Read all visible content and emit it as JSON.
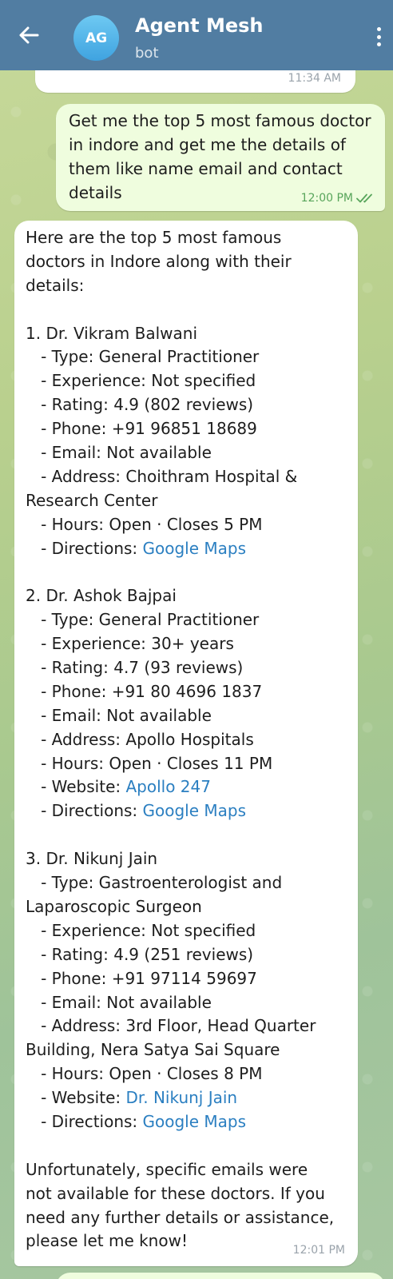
{
  "header": {
    "title": "Agent Mesh",
    "subtitle": "bot",
    "avatar_initials": "AG"
  },
  "previous_message": {
    "time": "11:34 AM"
  },
  "outgoing_message": {
    "text": "Get me the top 5 most famous doctor\nin indore and get me the details of\nthem like name email and contact\ndetails",
    "time": "12:00 PM",
    "status_icon": "double-check-icon"
  },
  "incoming_message": {
    "time": "12:01 PM",
    "lines": [
      {
        "text": "Here are the top 5 most famous"
      },
      {
        "text": "doctors in Indore along with their"
      },
      {
        "text": "details:"
      },
      {
        "text": ""
      },
      {
        "text": "1. Dr. Vikram Balwani"
      },
      {
        "text": "   - Type: General Practitioner"
      },
      {
        "text": "   - Experience: Not specified"
      },
      {
        "text": "   - Rating: 4.9 (802 reviews)"
      },
      {
        "text": "   - Phone: +91 96851 18689"
      },
      {
        "text": "   - Email: Not available"
      },
      {
        "text": "   - Address: Choithram Hospital &"
      },
      {
        "text": "Research Center"
      },
      {
        "text": "   - Hours: Open · Closes 5 PM"
      },
      {
        "text": "   - Directions: ",
        "link": "Google Maps"
      },
      {
        "text": ""
      },
      {
        "text": "2. Dr. Ashok Bajpai"
      },
      {
        "text": "   - Type: General Practitioner"
      },
      {
        "text": "   - Experience: 30+ years"
      },
      {
        "text": "   - Rating: 4.7 (93 reviews)"
      },
      {
        "text": "   - Phone: +91 80 4696 1837"
      },
      {
        "text": "   - Email: Not available"
      },
      {
        "text": "   - Address: Apollo Hospitals"
      },
      {
        "text": "   - Hours: Open · Closes 11 PM"
      },
      {
        "text": "   - Website: ",
        "link": "Apollo 247"
      },
      {
        "text": "   - Directions: ",
        "link": "Google Maps"
      },
      {
        "text": ""
      },
      {
        "text": "3. Dr. Nikunj Jain"
      },
      {
        "text": "   - Type: Gastroenterologist and"
      },
      {
        "text": "Laparoscopic Surgeon"
      },
      {
        "text": "   - Experience: Not specified"
      },
      {
        "text": "   - Rating: 4.9 (251 reviews)"
      },
      {
        "text": "   - Phone: +91 97114 59697"
      },
      {
        "text": "   - Email: Not available"
      },
      {
        "text": "   - Address: 3rd Floor, Head Quarter"
      },
      {
        "text": "Building, Nera Satya Sai Square"
      },
      {
        "text": "   - Hours: Open · Closes 8 PM"
      },
      {
        "text": "   - Website: ",
        "link": "Dr. Nikunj Jain"
      },
      {
        "text": "   - Directions: ",
        "link": "Google Maps"
      },
      {
        "text": ""
      },
      {
        "text": "Unfortunately, specific emails were"
      },
      {
        "text": "not available for these doctors. If you"
      },
      {
        "text": "need any further details or assistance,"
      },
      {
        "text": "please let me know!"
      }
    ]
  },
  "colors": {
    "header_bg": "#517da2",
    "outgoing_bg": "#effdde",
    "incoming_bg": "#ffffff",
    "link": "#2b7fc1",
    "read_check": "#58a55b"
  }
}
